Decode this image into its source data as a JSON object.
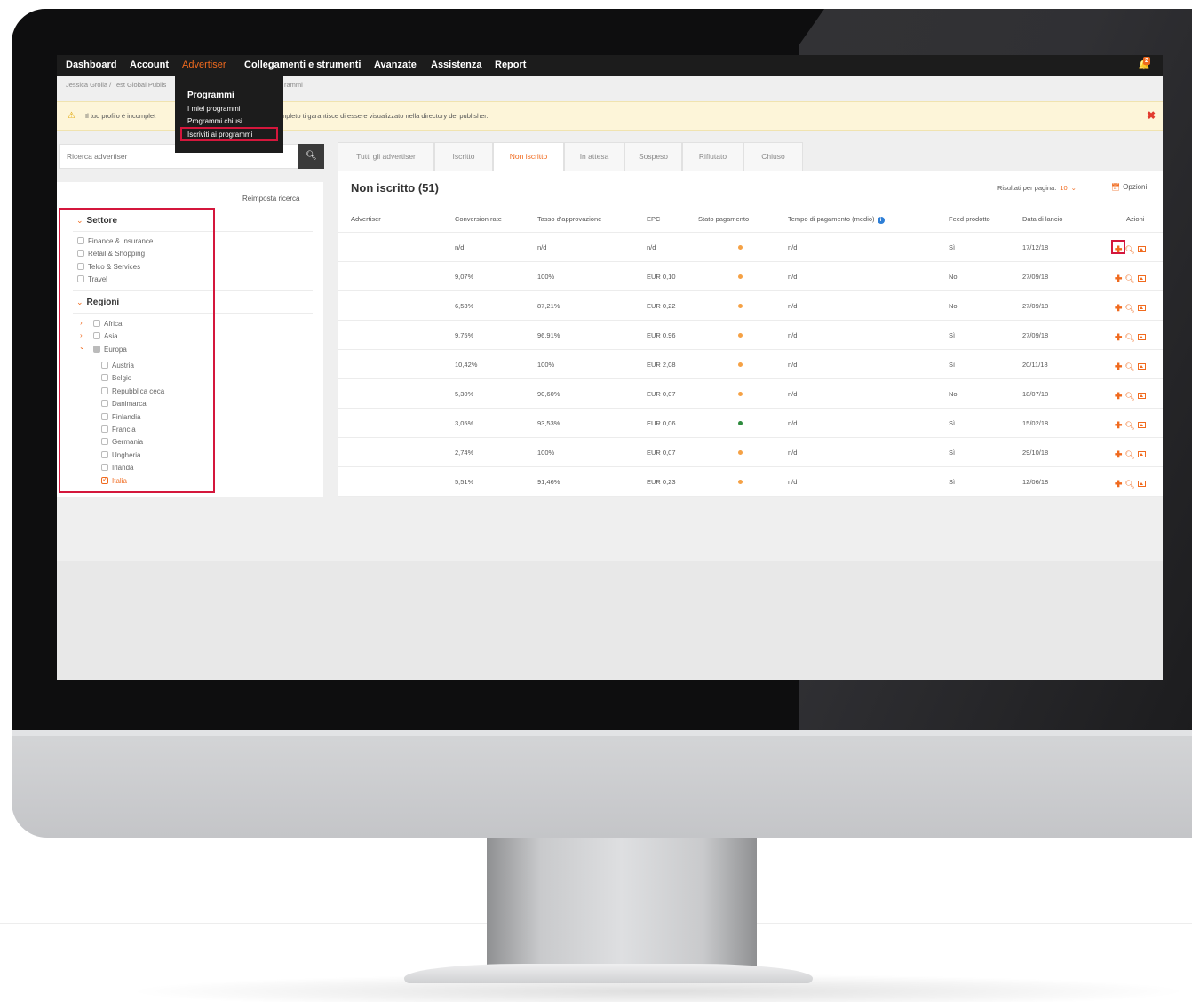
{
  "nav": {
    "items": [
      "Dashboard",
      "Account",
      "Advertiser",
      "Collegamenti e strumenti",
      "Avanzate",
      "Assistenza",
      "Report"
    ],
    "active": "Advertiser",
    "notifications": "2"
  },
  "breadcrumb": {
    "start": "Jessica Grolla / Test Global Publis",
    "tail": "rammi"
  },
  "warning": {
    "text_start": "Il tuo profilo è incomplet",
    "text_end": "mpleto ti garantisce di essere visualizzato nella directory dei publisher."
  },
  "dropdown": {
    "header": "Programmi",
    "options": [
      "I miei programmi",
      "Programmi chiusi",
      "Iscriviti ai programmi"
    ]
  },
  "search": {
    "placeholder": "Ricerca advertiser"
  },
  "filters": {
    "reset": "Reimposta ricerca",
    "settore": {
      "title": "Settore",
      "items": [
        "Finance & Insurance",
        "Retail & Shopping",
        "Telco & Services",
        "Travel"
      ]
    },
    "regioni": {
      "title": "Regioni",
      "top": [
        "Africa",
        "Asia",
        "Europa"
      ],
      "europa": [
        "Austria",
        "Belgio",
        "Repubblica ceca",
        "Danimarca",
        "Finlandia",
        "Francia",
        "Germania",
        "Ungheria",
        "Irlanda",
        "Italia"
      ],
      "checked": "Italia"
    }
  },
  "tabs": [
    "Tutti gli advertiser",
    "Iscritto",
    "Non iscritto",
    "In attesa",
    "Sospeso",
    "Rifiutato",
    "Chiuso"
  ],
  "active_tab": "Non iscritto",
  "table": {
    "title": "Non iscritto (51)",
    "per_page_label": "Risultati per pagina:",
    "per_page_value": "10",
    "options_label": "Opzioni",
    "columns": [
      "Advertiser",
      "Conversion rate",
      "Tasso d'approvazione",
      "EPC",
      "Stato pagamento",
      "Tempo di pagamento (medio)",
      "Feed prodotto",
      "Data di lancio",
      "Azioni"
    ],
    "rows": [
      {
        "advertiser": "",
        "conversion": "n/d",
        "approval": "n/d",
        "epc": "n/d",
        "status": "orange",
        "time": "n/d",
        "feed": "Sì",
        "date": "17/12/18"
      },
      {
        "advertiser": "",
        "conversion": "9,07%",
        "approval": "100%",
        "epc": "EUR 0,10",
        "status": "orange",
        "time": "n/d",
        "feed": "No",
        "date": "27/09/18"
      },
      {
        "advertiser": "",
        "conversion": "6,53%",
        "approval": "87,21%",
        "epc": "EUR 0,22",
        "status": "orange",
        "time": "n/d",
        "feed": "No",
        "date": "27/09/18"
      },
      {
        "advertiser": "",
        "conversion": "9,75%",
        "approval": "96,91%",
        "epc": "EUR 0,96",
        "status": "orange",
        "time": "n/d",
        "feed": "Sì",
        "date": "27/09/18"
      },
      {
        "advertiser": "",
        "conversion": "10,42%",
        "approval": "100%",
        "epc": "EUR 2,08",
        "status": "orange",
        "time": "n/d",
        "feed": "Sì",
        "date": "20/11/18"
      },
      {
        "advertiser": "",
        "conversion": "5,30%",
        "approval": "90,60%",
        "epc": "EUR 0,07",
        "status": "orange",
        "time": "n/d",
        "feed": "No",
        "date": "18/07/18"
      },
      {
        "advertiser": "",
        "conversion": "3,05%",
        "approval": "93,53%",
        "epc": "EUR 0,06",
        "status": "green",
        "time": "n/d",
        "feed": "Sì",
        "date": "15/02/18"
      },
      {
        "advertiser": "",
        "conversion": "2,74%",
        "approval": "100%",
        "epc": "EUR 0,07",
        "status": "orange",
        "time": "n/d",
        "feed": "Sì",
        "date": "29/10/18"
      },
      {
        "advertiser": "",
        "conversion": "5,51%",
        "approval": "91,46%",
        "epc": "EUR 0,23",
        "status": "orange",
        "time": "n/d",
        "feed": "Sì",
        "date": "12/06/18"
      }
    ]
  },
  "colors": {
    "accent": "#f06a1e",
    "highlight": "#d4173c",
    "status_orange": "#f5a145",
    "status_green": "#2e8b3e",
    "nav_bg": "#1c1c1c"
  }
}
